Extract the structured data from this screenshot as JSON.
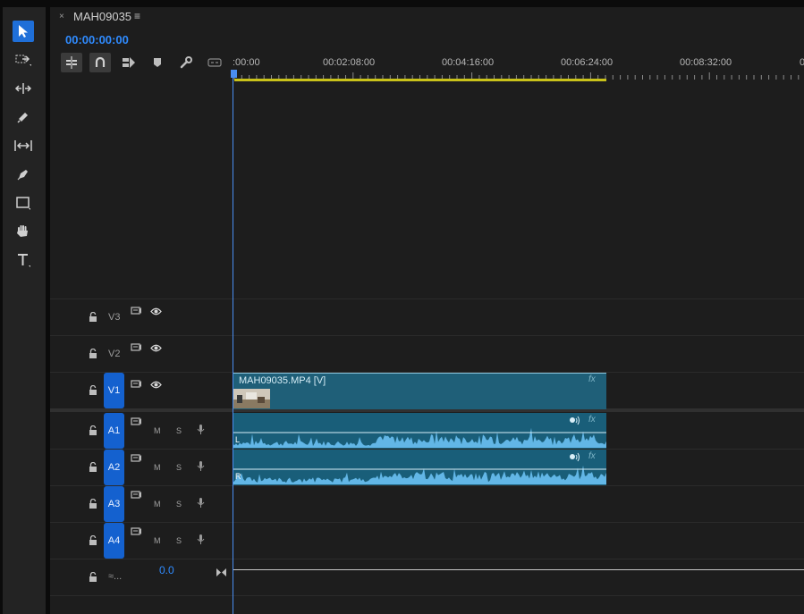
{
  "tab": {
    "title": "MAH09035",
    "close_glyph": "×",
    "menu_glyph": "≡"
  },
  "timecode": "00:00:00:00",
  "ruler": {
    "labels": [
      ":00:00",
      "00:02:08:00",
      "00:04:16:00",
      "00:06:24:00",
      "00:08:32:00",
      "0"
    ]
  },
  "tools": [
    "selection-tool-icon",
    "track-select-forward-icon",
    "ripple-edit-icon",
    "razor-icon",
    "slip-icon",
    "pen-icon",
    "rectangle-icon",
    "hand-icon",
    "type-icon"
  ],
  "controls": [
    "insert-nest-icon",
    "snap-icon",
    "linked-selection-icon",
    "add-marker-icon",
    "settings-wrench-icon",
    "captions-icon"
  ],
  "tracks": {
    "v3": {
      "label": "V3"
    },
    "v2": {
      "label": "V2"
    },
    "v1": {
      "label": "V1"
    },
    "a1": {
      "label": "A1",
      "m": "M",
      "s": "S"
    },
    "a2": {
      "label": "A2",
      "m": "M",
      "s": "S"
    },
    "a3": {
      "label": "A3",
      "m": "M",
      "s": "S"
    },
    "a4": {
      "label": "A4",
      "m": "M",
      "s": "S"
    },
    "master": {
      "label": "≈...",
      "volume": "0.0"
    }
  },
  "clips": {
    "video": {
      "name": "MAH09035.MP4 [V]",
      "fx": "fx"
    },
    "audio_left": {
      "channel": "L",
      "fx": "fx"
    },
    "audio_right": {
      "channel": "R",
      "fx": "fx"
    }
  },
  "colors": {
    "accent": "#2f8bff",
    "track_badge": "#1461cf",
    "clip_video": "#1f5f78",
    "clip_audio": "#195e79",
    "waveform": "#62b6e6",
    "work_area": "#c9c21a",
    "playhead": "#4a8df0"
  }
}
